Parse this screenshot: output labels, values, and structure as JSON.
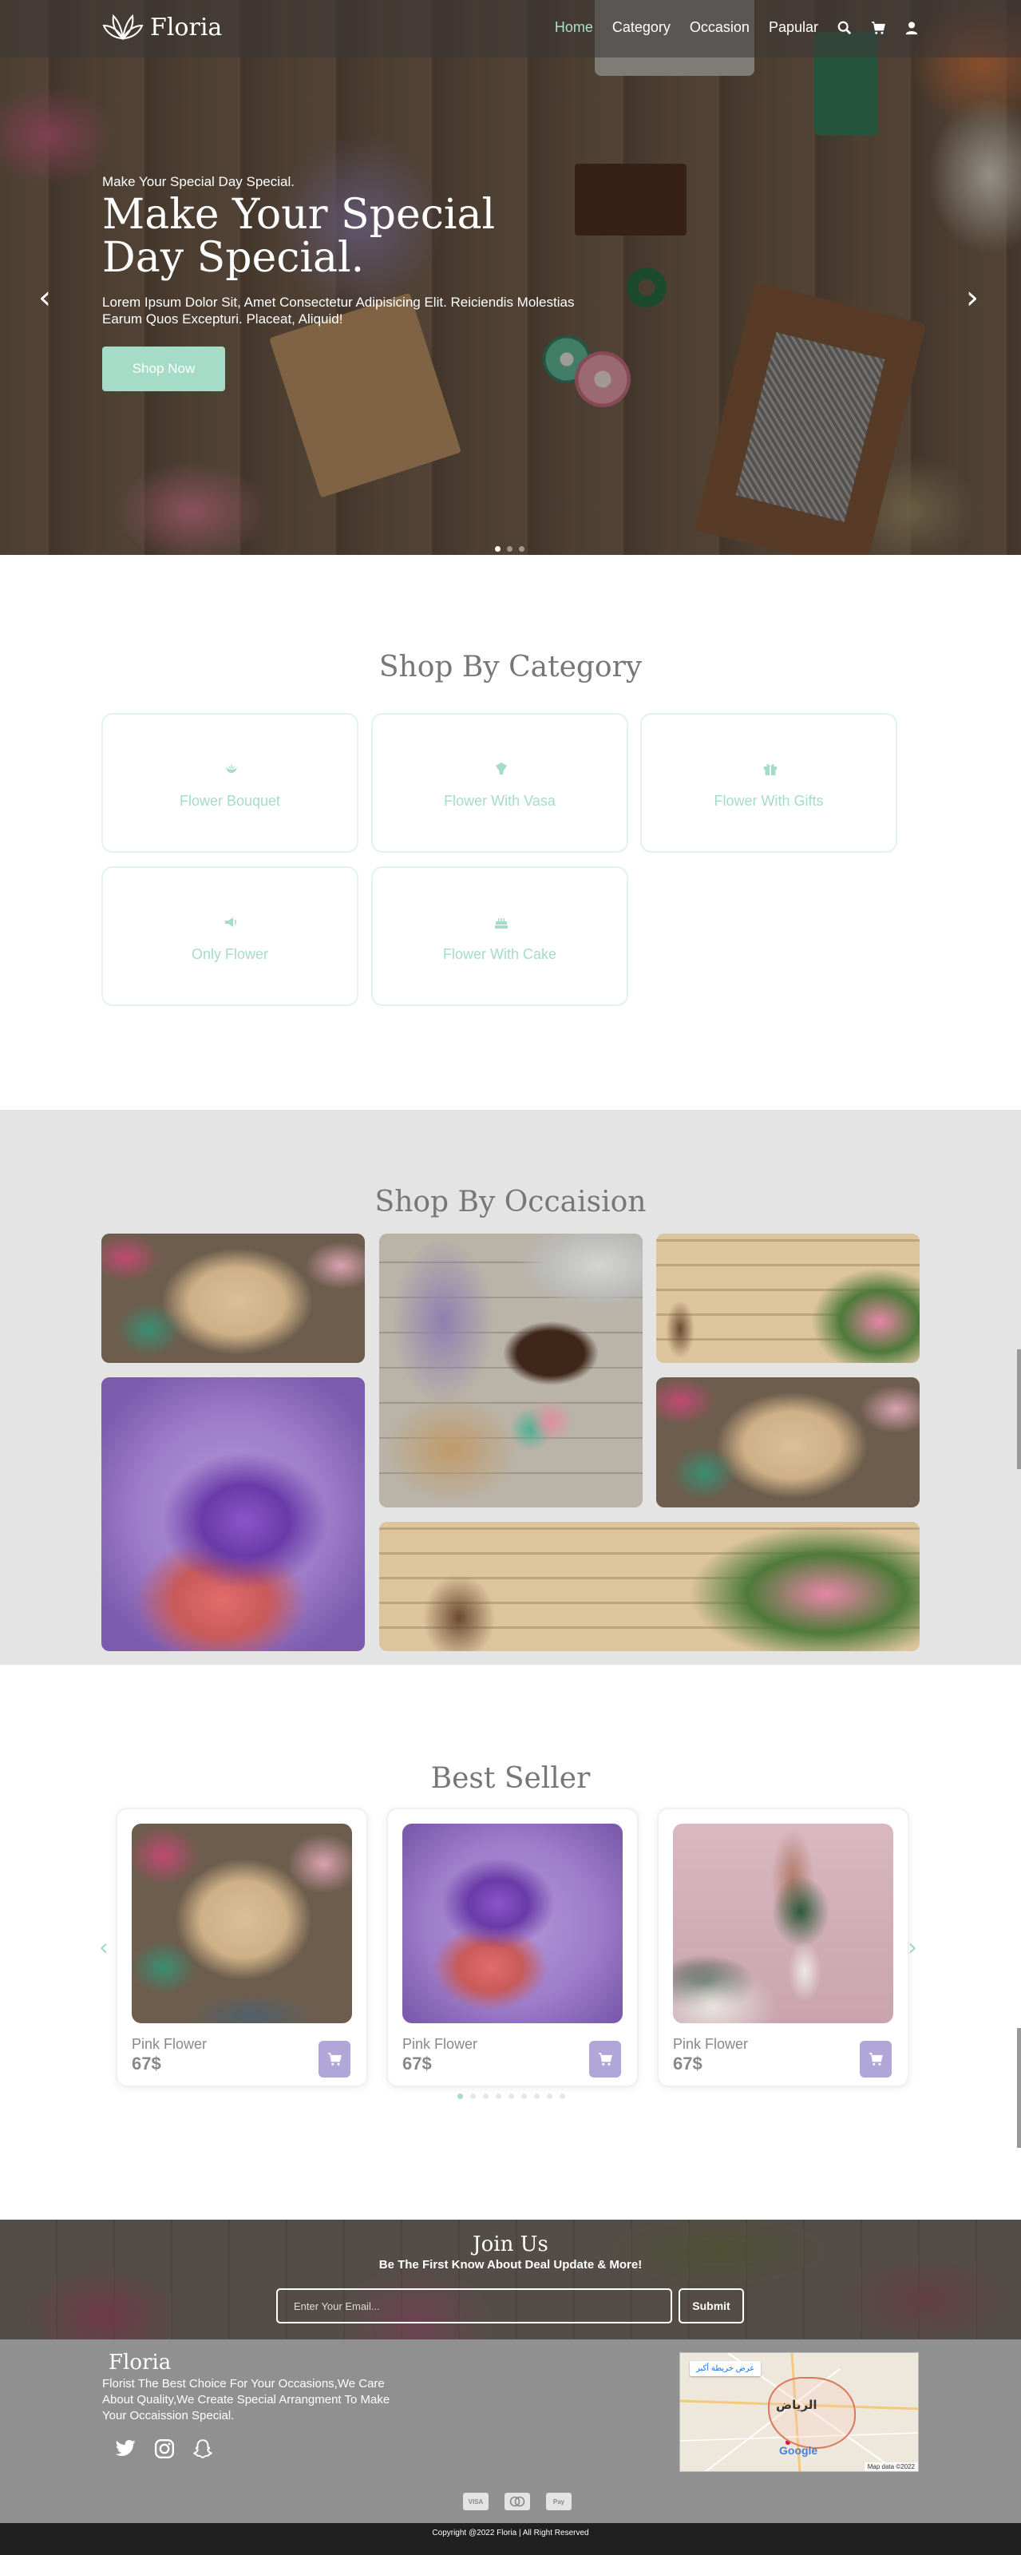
{
  "brand": {
    "name": "Floria"
  },
  "nav": {
    "items": [
      {
        "label": "Home",
        "active": true
      },
      {
        "label": "Category",
        "active": false
      },
      {
        "label": "Occasion",
        "active": false
      },
      {
        "label": "Papular",
        "active": false
      }
    ],
    "icons": [
      "search-icon",
      "cart-icon",
      "user-icon"
    ]
  },
  "hero": {
    "kicker": "Make Your Special Day Special.",
    "title": "Make Your Special Day Special.",
    "description": "Lorem Ipsum Dolor Sit, Amet Consectetur Adipisicing Elit. Reiciendis Molestias Earum Quos Excepturi. Placeat, Aliquid!",
    "button": "Shop Now",
    "slides": 3,
    "active_slide": 1
  },
  "category": {
    "title": "Shop By Category",
    "items": [
      {
        "label": "Flower Bouquet",
        "icon": "bouquet-icon"
      },
      {
        "label": "Flower With Vasa",
        "icon": "vase-icon"
      },
      {
        "label": "Flower With Gifts",
        "icon": "gift-icon"
      },
      {
        "label": "Only Flower",
        "icon": "flower-icon"
      },
      {
        "label": "Flower With Cake",
        "icon": "cake-icon"
      }
    ]
  },
  "occasion": {
    "title": "Shop By Occaision"
  },
  "best_seller": {
    "title": "Best Seller",
    "products": [
      {
        "name": "Pink Flower",
        "price": "67$"
      },
      {
        "name": "Pink Flower",
        "price": "67$"
      },
      {
        "name": "Pink Flower",
        "price": "67$"
      }
    ],
    "pages": 9,
    "active_page": 1
  },
  "join": {
    "title": "Join Us",
    "subtitle": "Be The First Know About Deal Update & More!",
    "email_placeholder": "Enter Your Email...",
    "submit": "Submit"
  },
  "footer": {
    "logo": "Floria",
    "description": "Florist The Best Choice For Your Occasions,We Care About Quality,We Create Special Arrangment To Make Your Occaission Special.",
    "social": [
      "twitter-icon",
      "instagram-icon",
      "snapchat-icon"
    ],
    "map": {
      "view_larger": "عرض خريطة أكبر",
      "city": "الرياض",
      "attribution": "Map data ©2022",
      "google": "Google"
    },
    "payments": [
      "VISA",
      "MC",
      "Pay"
    ],
    "copyright": "Copyright @2022 Floria | All Right Reserved"
  },
  "colors": {
    "accent": "#a5dcc7",
    "cart": "#b1a6d8",
    "footer": "#909090",
    "bottom_bar": "#202020"
  }
}
